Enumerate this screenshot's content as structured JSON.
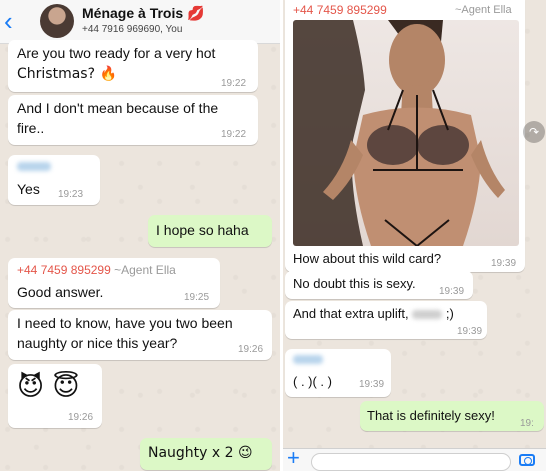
{
  "left_chat": {
    "header": {
      "back_icon": "chevron-left-icon",
      "title": "Ménage à Trois",
      "title_emoji": "💋",
      "subtitle": "+44 7916 969690, You"
    },
    "messages": [
      {
        "text1": "Are you two ready for a very hot",
        "text2": "Christmas? 🔥",
        "time": "19:22"
      },
      {
        "text1": "And I don't mean because of the",
        "text2": "fire..",
        "time": "19:22"
      },
      {
        "text": "Yes",
        "time": "19:23"
      },
      {
        "text": "I hope so haha"
      },
      {
        "sender": "+44 7459 895299",
        "role": "~Agent Ella",
        "text": "Good answer.",
        "time": "19:25"
      },
      {
        "text1": "I need to know, have you two been",
        "text2": "naughty or nice this year?",
        "time": "19:26"
      },
      {
        "emojis": "😈 😇",
        "time": "19:26"
      },
      {
        "text": "Naughty x 2 😉"
      }
    ]
  },
  "right_chat": {
    "messages": [
      {
        "sender": "+44 7459 895299",
        "role": "~Agent Ella",
        "caption": "How about this wild card?",
        "time": "19:39"
      },
      {
        "text": "No doubt this is sexy.",
        "time": "19:39"
      },
      {
        "text_pre": "And that extra uplift, ",
        "text_post": " ;)",
        "time": "19:39"
      },
      {
        "text": "( . )( . )",
        "time": "19:39"
      },
      {
        "text": "That is definitely sexy!",
        "time": "19:"
      }
    ],
    "input": {
      "plus_icon": "plus-icon",
      "camera_icon": "camera-icon"
    }
  },
  "colors": {
    "outgoing": "#dcf8c6",
    "incoming": "#ffffff",
    "sender": "#e4564a",
    "accent": "#1a7cf5"
  }
}
